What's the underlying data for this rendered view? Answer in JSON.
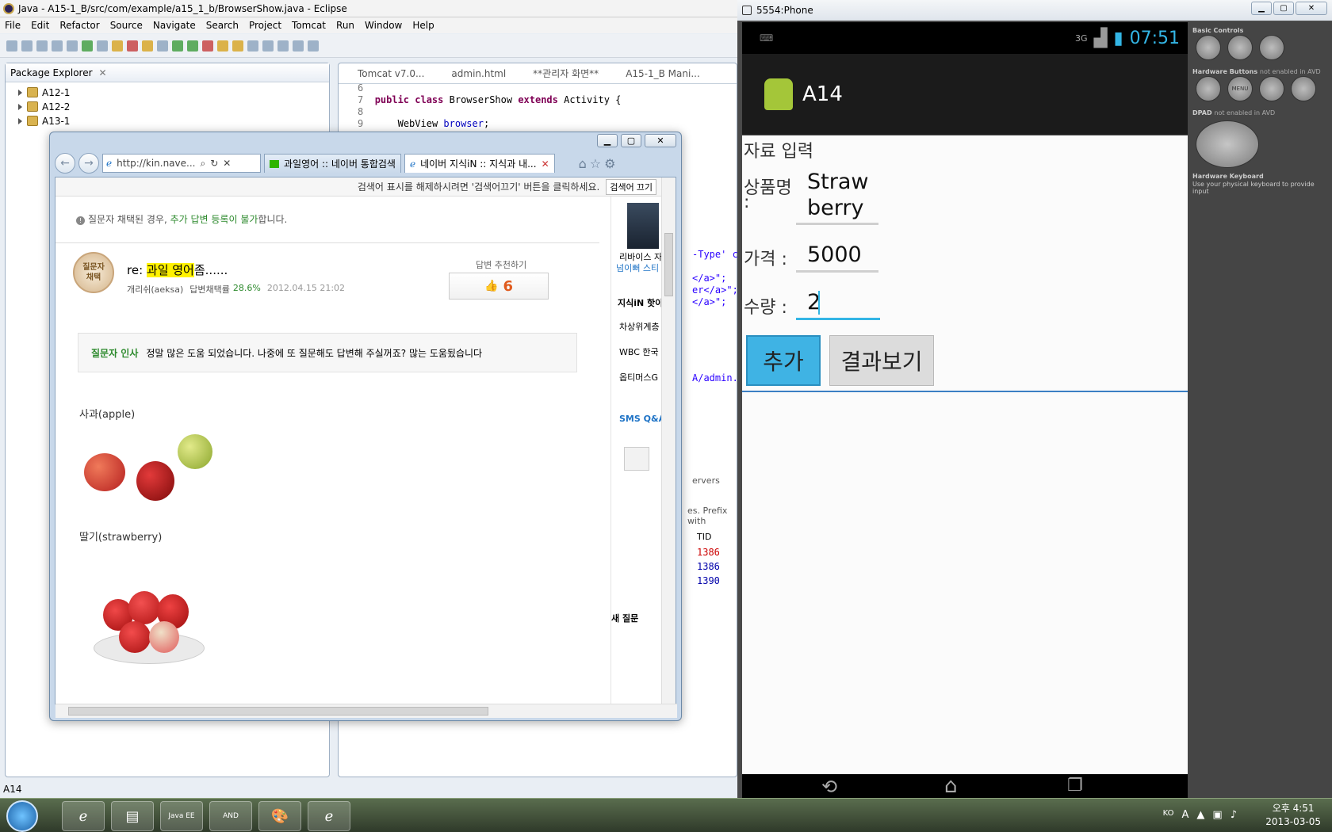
{
  "eclipse": {
    "title": "Java - A15-1_B/src/com/example/a15_1_b/BrowserShow.java - Eclipse",
    "menu": [
      "File",
      "Edit",
      "Refactor",
      "Source",
      "Navigate",
      "Search",
      "Project",
      "Tomcat",
      "Run",
      "Window",
      "Help"
    ],
    "package_explorer_title": "Package Explorer",
    "projects": [
      "A12-1",
      "A12-2",
      "A13-1"
    ],
    "editor_tabs": [
      "Tomcat v7.0...",
      "admin.html",
      "**관리자 화면**",
      "A15-1_B Mani..."
    ],
    "code": {
      "l6": "6",
      "l7": "7",
      "l8": "8",
      "l9": "9",
      "line7_kw1": "public class",
      "line7_name": " BrowserShow ",
      "line7_kw2": "extends",
      "line7_rest": " Activity {",
      "line9_type": "WebView ",
      "line9_field": "browser",
      "line9_end": ";"
    },
    "behind_fragments": [
      "-Type' con",
      "</a>\";",
      "er</a>\";",
      "</a>\";",
      "A/admin.htm",
      "ervers",
      "es. Prefix with",
      "TID",
      "1386",
      "1386",
      "1390"
    ],
    "status": "A14"
  },
  "ie": {
    "address": "http://kin.nave...",
    "tabs": [
      "과일영어 :: 네이버 통합검색",
      "네이버 지식iN :: 지식과 내..."
    ],
    "search_bar_text": "검색어 표시를 해제하시려면 '검색어끄기' 버튼을 클릭하세요.",
    "search_off_button": "검색어 끄기",
    "notice_pre": "질문자 채택된 경우, ",
    "notice_link": "추가 답변 등록이 불가",
    "notice_post": "합니다.",
    "medal_line1": "질문자",
    "medal_line2": "채택",
    "answer_title_pre": "re: ",
    "answer_title_hl": "과일 영어",
    "answer_title_post": "좀......",
    "author": "개리쉬(aeksa)",
    "rate_label": "답변채택률",
    "rate_value": "28.6%",
    "date": "2012.04.15 21:02",
    "recommend_label": "답변 추천하기",
    "recommend_count": "6",
    "greeting_label": "질문자 인사",
    "greeting_text": "정말 많은 도움 되었습니다. 나중에 또 질문해도 답변해 주실꺼죠? 많는 도움됬습니다",
    "apple_label": "사과(apple)",
    "strawberry_label": "딸기(strawberry)",
    "side_items": [
      "리바이스 자",
      "넘이뻐 스티",
      "지식iN 핫이",
      "차상위계층",
      "WBC 한국",
      "옵티머스G",
      "SMS Q&A",
      "새 질문"
    ]
  },
  "emulator": {
    "window_title": "5554:Phone",
    "clock": "07:51",
    "network": "3G",
    "app_title": "A14",
    "section_label": "자료 입력",
    "name_label": "상품명",
    "name_colon": ":",
    "name_value_line1": "Straw",
    "name_value_line2": "berry",
    "price_label": "가격 :",
    "price_value": "5000",
    "qty_label": "수량 :",
    "qty_value": "2",
    "add_button": "추가",
    "result_button": "결과보기",
    "side_captions": {
      "basic": "Basic Controls",
      "hardware": "Hardware Buttons",
      "hardware_note": "not enabled in AVD",
      "dpad": "DPAD",
      "dpad_note": "not enabled in AVD",
      "keyboard": "Hardware Keyboard",
      "keyboard_note": "Use your physical keyboard to provide input",
      "menu": "MENU"
    }
  },
  "taskbar": {
    "lang": "KO",
    "time": "오후 4:51",
    "date": "2013-03-05",
    "apps": [
      "Java EE",
      "AND"
    ]
  }
}
